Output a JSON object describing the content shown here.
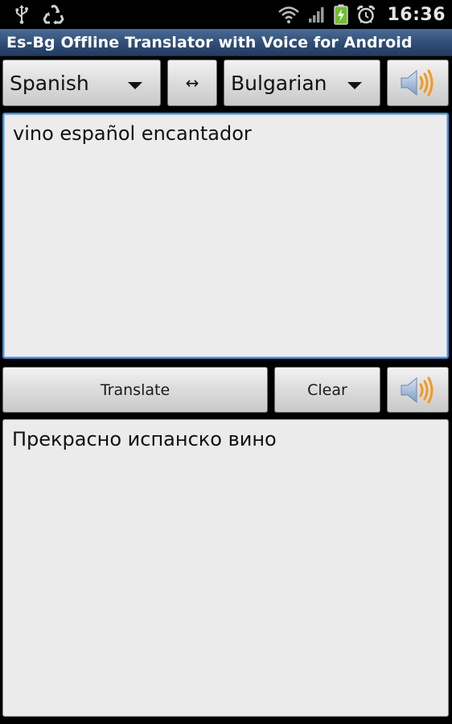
{
  "status_bar": {
    "time": "16:36",
    "left_icons": [
      "usb-icon",
      "recycle-icon"
    ],
    "right_icons": [
      "wifi-icon",
      "signal-icon",
      "battery-charging-icon",
      "alarm-icon"
    ]
  },
  "app": {
    "title": "Es-Bg Offline Translator with Voice for Android"
  },
  "language_bar": {
    "source_language": "Spanish",
    "swap_symbol": "↔",
    "target_language": "Bulgarian"
  },
  "input": {
    "text": "vino español encantador"
  },
  "actions": {
    "translate_label": "Translate",
    "clear_label": "Clear"
  },
  "output": {
    "text": "Прекрасно испанско вино"
  },
  "colors": {
    "title_bar": "#2f4d76",
    "input_focus_border": "#3d8fd6",
    "speaker_wave": "#f39a1e",
    "speaker_body": "#9fb7d8"
  }
}
